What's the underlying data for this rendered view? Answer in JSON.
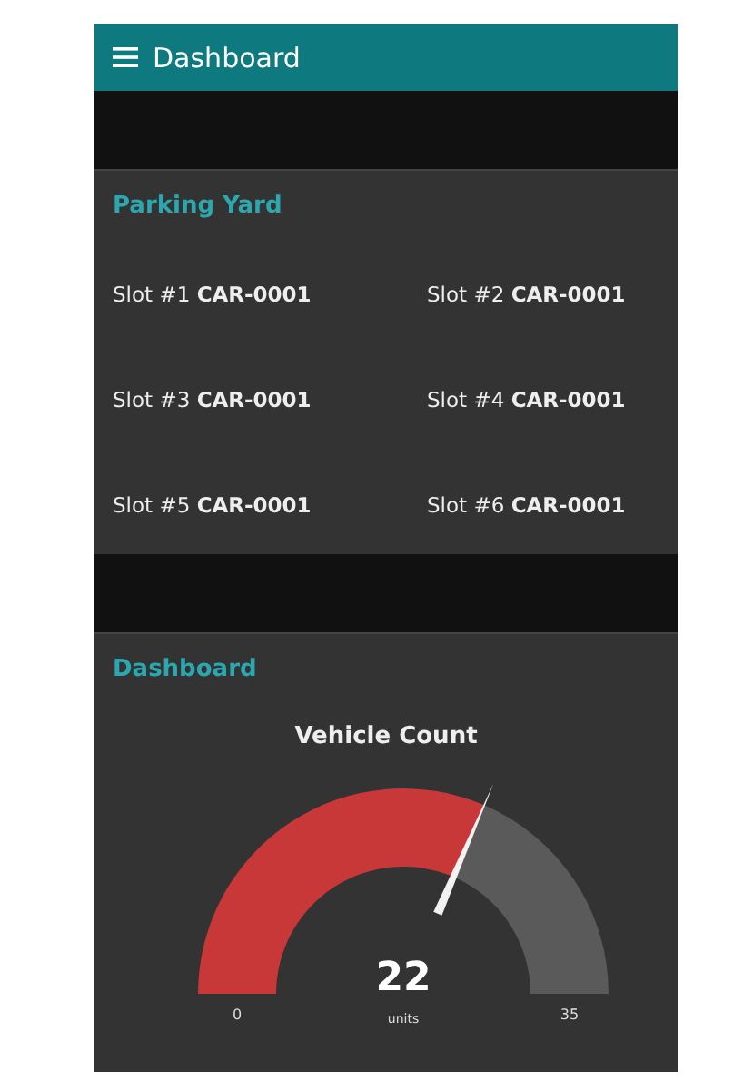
{
  "header": {
    "title": "Dashboard"
  },
  "parking_yard": {
    "title": "Parking Yard",
    "slots": [
      {
        "text": "Slot #1 **CAR-0001**"
      },
      {
        "text": "Slot #2 **CAR-0001**"
      },
      {
        "text": "Slot #3 **CAR-0001**"
      },
      {
        "text": "Slot #4 **CAR-0001**"
      },
      {
        "text": "Slot #5 **CAR-0001**"
      },
      {
        "text": "Slot #6 **CAR-0001**"
      }
    ]
  },
  "dashboard": {
    "title": "Dashboard",
    "gauge": {
      "title": "Vehicle Count",
      "value": "22",
      "units": "units",
      "min": "0",
      "max": "35",
      "level": 0.629
    }
  }
}
